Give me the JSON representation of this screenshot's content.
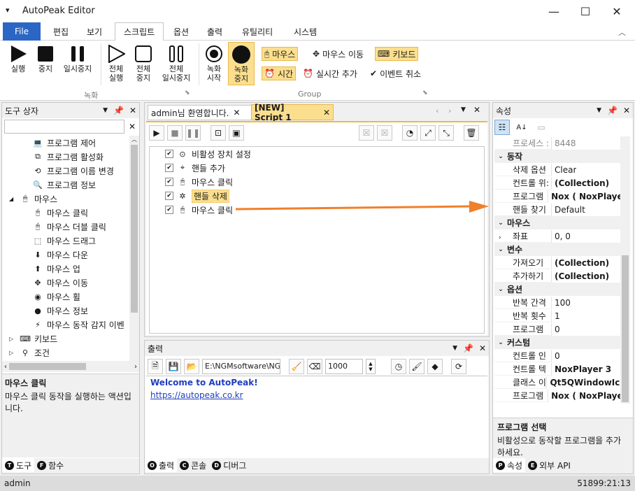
{
  "window": {
    "title": "AutoPeak Editor"
  },
  "ribbon_tabs": [
    "File",
    "편집",
    "보기",
    "스크립트",
    "옵션",
    "출력",
    "유틸리티",
    "시스템"
  ],
  "ribbon": {
    "run": "실행",
    "stop": "중지",
    "pause": "일시중지",
    "all_run": "전체\n실행",
    "all_stop": "전체\n중지",
    "all_pause": "전체\n일시중지",
    "rec_start": "녹화\n시작",
    "rec_stop": "녹화\n중지",
    "group_record": "녹화",
    "group_group": "Group",
    "mouse": "마우스",
    "mouse_move": "마우스 이동",
    "keyboard": "키보드",
    "time": "시간",
    "realtime_add": "실시간 추가",
    "event_cancel": "이벤트 취소"
  },
  "toolbox": {
    "title": "도구 상자",
    "items": [
      {
        "label": "프로그램 제어",
        "icon": "monitor-icon",
        "indent": 2
      },
      {
        "label": "프로그램 활성화",
        "icon": "window-icon",
        "indent": 2
      },
      {
        "label": "프로그램 이름 변경",
        "icon": "rename-icon",
        "indent": 2
      },
      {
        "label": "프로그램 정보",
        "icon": "search-icon",
        "indent": 2
      },
      {
        "label": "마우스",
        "icon": "mouse-icon",
        "indent": 1,
        "expand": "◢"
      },
      {
        "label": "마우스 클릭",
        "icon": "mouse-click-icon",
        "indent": 2
      },
      {
        "label": "마우스 더블 클릭",
        "icon": "mouse-dblclick-icon",
        "indent": 2
      },
      {
        "label": "마우스 드래그",
        "icon": "mouse-drag-icon",
        "indent": 2
      },
      {
        "label": "마우스 다운",
        "icon": "mouse-down-icon",
        "indent": 2
      },
      {
        "label": "마우스 업",
        "icon": "mouse-up-icon",
        "indent": 2
      },
      {
        "label": "마우스 이동",
        "icon": "move-icon",
        "indent": 2
      },
      {
        "label": "마우스 휠",
        "icon": "mouse-wheel-icon",
        "indent": 2
      },
      {
        "label": "마우스 정보",
        "icon": "mouse-info-icon",
        "indent": 2
      },
      {
        "label": "마우스 동작 감지 이벤",
        "icon": "lightning-icon",
        "indent": 2
      },
      {
        "label": "키보드",
        "icon": "keyboard-icon",
        "indent": 1,
        "expand": "▷"
      },
      {
        "label": "조건",
        "icon": "condition-icon",
        "indent": 1,
        "expand": "▷"
      }
    ],
    "desc_title": "마우스 클릭",
    "desc_text": "마우스 클릭 동작을 실행하는 액션입니다.",
    "tabs": [
      {
        "label": "도구",
        "key": "T"
      },
      {
        "label": "함수",
        "key": "F"
      }
    ]
  },
  "doc_tabs": [
    {
      "label": "admin님 환영합니다."
    },
    {
      "label": "[NEW] Script 1"
    }
  ],
  "script": {
    "items": [
      {
        "label": "비활성 장치 설정",
        "icon": "target-icon"
      },
      {
        "label": "핸들 추가",
        "icon": "crosshair-icon"
      },
      {
        "label": "마우스 클릭",
        "icon": "mouse-click-icon"
      },
      {
        "label": "핸들 삭제",
        "icon": "delete-target-icon",
        "selected": true
      },
      {
        "label": "마우스 클릭",
        "icon": "mouse-click-icon"
      }
    ]
  },
  "output": {
    "title": "출력",
    "path": "E:\\NGMsoftware\\NG",
    "interval": "1000",
    "welcome": "Welcome to AutoPeak!",
    "link": "https://autopeak.co.kr",
    "tabs": [
      {
        "label": "출력",
        "key": "O"
      },
      {
        "label": "콘솔",
        "key": "C"
      },
      {
        "label": "디버그",
        "key": "D"
      }
    ]
  },
  "properties": {
    "title": "속성",
    "rows": [
      {
        "type": "prop",
        "name": "프로세스 :",
        "value": "8448",
        "dim": true
      },
      {
        "type": "cat",
        "name": "동작"
      },
      {
        "type": "prop",
        "name": "삭제 옵션",
        "value": "Clear"
      },
      {
        "type": "prop",
        "name": "컨트롤 위:",
        "value": "(Collection)",
        "bold": true
      },
      {
        "type": "prop",
        "name": "프로그램",
        "value": "Nox ( NoxPlayer",
        "bold": true
      },
      {
        "type": "prop",
        "name": "핸들 찾기",
        "value": "Default"
      },
      {
        "type": "cat",
        "name": "마우스"
      },
      {
        "type": "prop",
        "name": "좌표",
        "value": "0, 0",
        "expand": true
      },
      {
        "type": "cat",
        "name": "변수"
      },
      {
        "type": "prop",
        "name": "가져오기",
        "value": "(Collection)",
        "bold": true
      },
      {
        "type": "prop",
        "name": "추가하기",
        "value": "(Collection)",
        "bold": true
      },
      {
        "type": "cat",
        "name": "옵션"
      },
      {
        "type": "prop",
        "name": "반복 간격",
        "value": "100"
      },
      {
        "type": "prop",
        "name": "반복 횟수",
        "value": "1"
      },
      {
        "type": "prop",
        "name": "프로그램",
        "value": "0"
      },
      {
        "type": "cat",
        "name": "커스텀"
      },
      {
        "type": "prop",
        "name": "컨트롤 인",
        "value": "0"
      },
      {
        "type": "prop",
        "name": "컨트롤 텍",
        "value": "NoxPlayer 3",
        "bold": true
      },
      {
        "type": "prop",
        "name": "클래스 이",
        "value": "Qt5QWindowIcor",
        "bold": true
      },
      {
        "type": "prop",
        "name": "프로그램",
        "value": "Nox ( NoxPlayer",
        "bold": true
      }
    ],
    "desc_title": "프로그램 선택",
    "desc_text": "비활성으로 동작할 프로그램을 추가하세요.",
    "tabs": [
      {
        "label": "속성",
        "key": "P"
      },
      {
        "label": "외부 API",
        "key": "E"
      }
    ]
  },
  "status": {
    "user": "admin",
    "time": "51899:21:13"
  },
  "colors": {
    "accent": "#2b66c4",
    "highlight": "#fcdf8e",
    "arrow": "#f0802a"
  }
}
